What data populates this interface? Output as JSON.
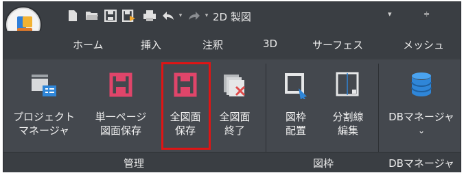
{
  "window": {
    "document_title": "2D 製図",
    "ctrl_dropdown": "▾",
    "ctrl_customize": "≑"
  },
  "quick_access": {
    "icons": [
      "new-file-icon",
      "open-folder-icon",
      "save-icon",
      "save-as-icon",
      "print-icon",
      "undo-icon",
      "redo-icon"
    ],
    "undo_drop": "▾",
    "redo_drop": "▾"
  },
  "tabs": [
    "ホーム",
    "挿入",
    "注釈",
    "3D",
    "サーフェス",
    "メッシュ"
  ],
  "ribbon": {
    "buttons": [
      {
        "line1": "プロジェクト",
        "line2": "マネージャ"
      },
      {
        "line1": "単一ページ",
        "line2": "図面保存"
      },
      {
        "line1": "全図面",
        "line2": "保存"
      },
      {
        "line1": "全図面",
        "line2": "終了"
      },
      {
        "line1": "図枠",
        "line2": "配置"
      },
      {
        "line1": "分割線",
        "line2": "編集"
      },
      {
        "line1": "DBマネージャ",
        "line2": "⌄"
      }
    ]
  },
  "groups": [
    "管理",
    "図枠",
    "DBマネージャ"
  ],
  "colors": {
    "accent_red": "#e04a6a",
    "selection": "#e01414",
    "db_blue": "#2f86d8"
  }
}
